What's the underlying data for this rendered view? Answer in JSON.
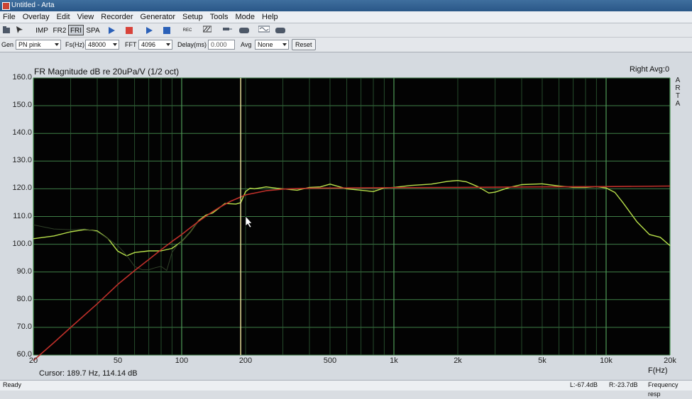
{
  "window": {
    "title": "Untitled - Arta"
  },
  "menu": [
    "File",
    "Overlay",
    "Edit",
    "View",
    "Recorder",
    "Generator",
    "Setup",
    "Tools",
    "Mode",
    "Help"
  ],
  "toolbar": {
    "imp_label": "IMP",
    "fr2_label": "FR2",
    "fr1_label": "FRI",
    "spa_label": "SPA",
    "rec_label": "REC"
  },
  "params": {
    "gen_label": "Gen",
    "gen_value": "PN pink",
    "fs_label": "Fs(Hz)",
    "fs_value": "48000",
    "fft_label": "FFT",
    "fft_value": "4096",
    "delay_label": "Delay(ms)",
    "delay_value": "0.000",
    "avg_label": "Avg",
    "avg_value": "None",
    "reset_label": "Reset"
  },
  "chart_header": {
    "title": "FR Magnitude dB re 20uPa/V (1/2 oct)",
    "right": "Right  Avg:0",
    "watermark": [
      "A",
      "R",
      "T",
      "A"
    ]
  },
  "cursor_readout": "Cursor:    189.7 Hz, 114.14 dB",
  "status": {
    "left": "Ready",
    "l_level": "L:-67.4dB",
    "r_level": "R:-23.7dB",
    "right": "Frequency resp"
  },
  "chart_data": {
    "type": "line",
    "title": "FR Magnitude dB re 20uPa/V (1/2 oct)",
    "xlabel": "F(Hz)",
    "ylabel": "",
    "x_scale": "log",
    "xlim": [
      20,
      20000
    ],
    "ylim": [
      60,
      160
    ],
    "y_ticks": [
      "160.0",
      "150.0",
      "140.0",
      "130.0",
      "120.0",
      "110.0",
      "100.0",
      "90.0",
      "80.0",
      "70.0",
      "60.0"
    ],
    "x_ticks": [
      {
        "value": 20,
        "label": "20"
      },
      {
        "value": 50,
        "label": "50"
      },
      {
        "value": 100,
        "label": "100"
      },
      {
        "value": 200,
        "label": "200"
      },
      {
        "value": 500,
        "label": "500"
      },
      {
        "value": 1000,
        "label": "1k"
      },
      {
        "value": 2000,
        "label": "2k"
      },
      {
        "value": 5000,
        "label": "5k"
      },
      {
        "value": 10000,
        "label": "10k"
      },
      {
        "value": 20000,
        "label": "20k"
      }
    ],
    "grid": true,
    "cursor_x": 189.7,
    "series": [
      {
        "color": "#b8e04a",
        "width": 1.4,
        "x": [
          20,
          25,
          30,
          35,
          40,
          45,
          50,
          55,
          60,
          70,
          80,
          90,
          100,
          110,
          120,
          130,
          140,
          160,
          180,
          190,
          200,
          210,
          220,
          250,
          280,
          300,
          350,
          400,
          450,
          500,
          600,
          700,
          800,
          900,
          1000,
          1200,
          1500,
          1800,
          2000,
          2200,
          2500,
          2800,
          3000,
          3500,
          4000,
          5000,
          6000,
          7000,
          8000,
          9000,
          10000,
          11000,
          12000,
          14000,
          16000,
          18000,
          20000
        ],
        "y": [
          102,
          103,
          104.5,
          105.3,
          104.8,
          102,
          97.5,
          95.8,
          97,
          97.6,
          97.6,
          98.5,
          101,
          104.5,
          108.5,
          110.5,
          111.3,
          114.7,
          114.5,
          115,
          119,
          120.2,
          120,
          120.7,
          120.2,
          120,
          119.5,
          120.5,
          120.7,
          121.7,
          120,
          119.5,
          119,
          120.3,
          120.5,
          121.2,
          121.7,
          122.7,
          123,
          122.5,
          120.7,
          118.5,
          118.8,
          120.5,
          121.5,
          121.8,
          121,
          120.5,
          120.5,
          120.8,
          120.3,
          118.7,
          115,
          108,
          103.5,
          102.5,
          99.5
        ]
      },
      {
        "color": "#2f3f28",
        "width": 1.0,
        "x": [
          20,
          25,
          30,
          35,
          40,
          45,
          50,
          55,
          60,
          65,
          70,
          75,
          80,
          85,
          90,
          95,
          100,
          110,
          120
        ],
        "y": [
          107,
          105.5,
          105.2,
          105.5,
          104.5,
          102,
          99.5,
          96,
          92,
          90.8,
          90.8,
          91.5,
          92,
          90.5,
          97,
          99.5,
          101,
          104.5,
          108.5
        ]
      },
      {
        "color": "#c0302a",
        "width": 1.6,
        "x": [
          20,
          25,
          30,
          40,
          50,
          60,
          70,
          80,
          90,
          100,
          110,
          120,
          130,
          140,
          150,
          170,
          200,
          250,
          300,
          400,
          600,
          1000,
          2000,
          5000,
          10000,
          20000
        ],
        "y": [
          58,
          64.5,
          70,
          78.5,
          85.5,
          90.5,
          94.5,
          98,
          101,
          103.5,
          106,
          108.2,
          110.1,
          111.8,
          113.2,
          115.5,
          117.8,
          119.3,
          119.9,
          120.2,
          120.3,
          120.4,
          120.5,
          120.7,
          120.8,
          121
        ]
      }
    ]
  }
}
